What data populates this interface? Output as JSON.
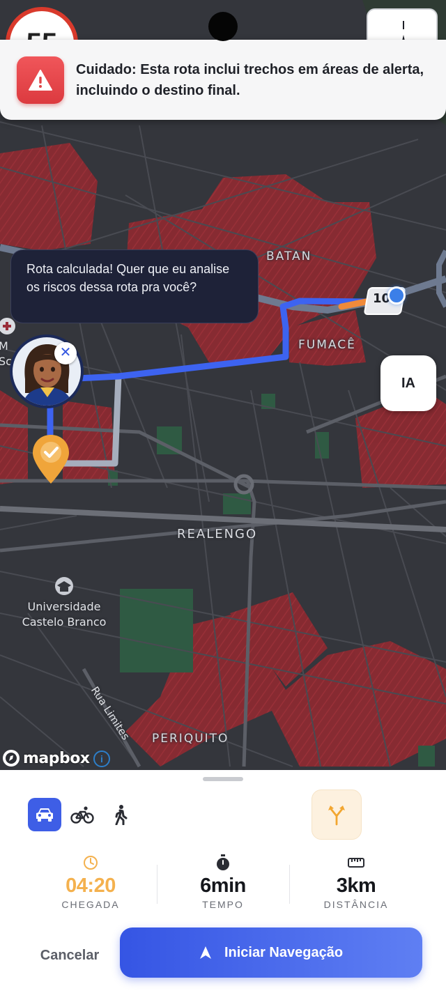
{
  "speed_limit": "55",
  "alert": {
    "icon": "warning-triangle-icon",
    "message": "Cuidado: Esta rota inclui trechos em áreas de alerta, incluindo o destino final."
  },
  "assistant": {
    "message": "Rota calculada! Quer que eu analise os riscos dessa rota pra você?",
    "close_label": "✕"
  },
  "map": {
    "labels": {
      "batan": "BATAN",
      "fumace": "FUMACÊ",
      "realengo": "REALENGO",
      "periquito": "PERIQUITO",
      "university": "Universidade Castelo Branco",
      "street": "Rua Limites",
      "partial_left": "M",
      "partial_left2": "Sc",
      "route_shield": "10"
    },
    "ia_button": "IA",
    "attribution": "mapbox",
    "info": "i"
  },
  "sheet": {
    "modes": [
      "car-icon",
      "bike-icon",
      "walk-icon"
    ],
    "routes_icon": "fork-route-icon",
    "stats": {
      "arrival": {
        "value": "04:20",
        "label": "CHEGADA",
        "icon": "clock-icon"
      },
      "time": {
        "value": "6min",
        "label": "TEMPO",
        "icon": "stopwatch-icon"
      },
      "distance": {
        "value": "3km",
        "label": "DISTÂNCIA",
        "icon": "ruler-icon"
      }
    },
    "cancel_label": "Cancelar",
    "start_label": "Iniciar Navegação"
  },
  "colors": {
    "danger": "#dc3a3f",
    "route": "#3d63f0",
    "accent": "#f4b14e",
    "primary": "#3555e4"
  }
}
